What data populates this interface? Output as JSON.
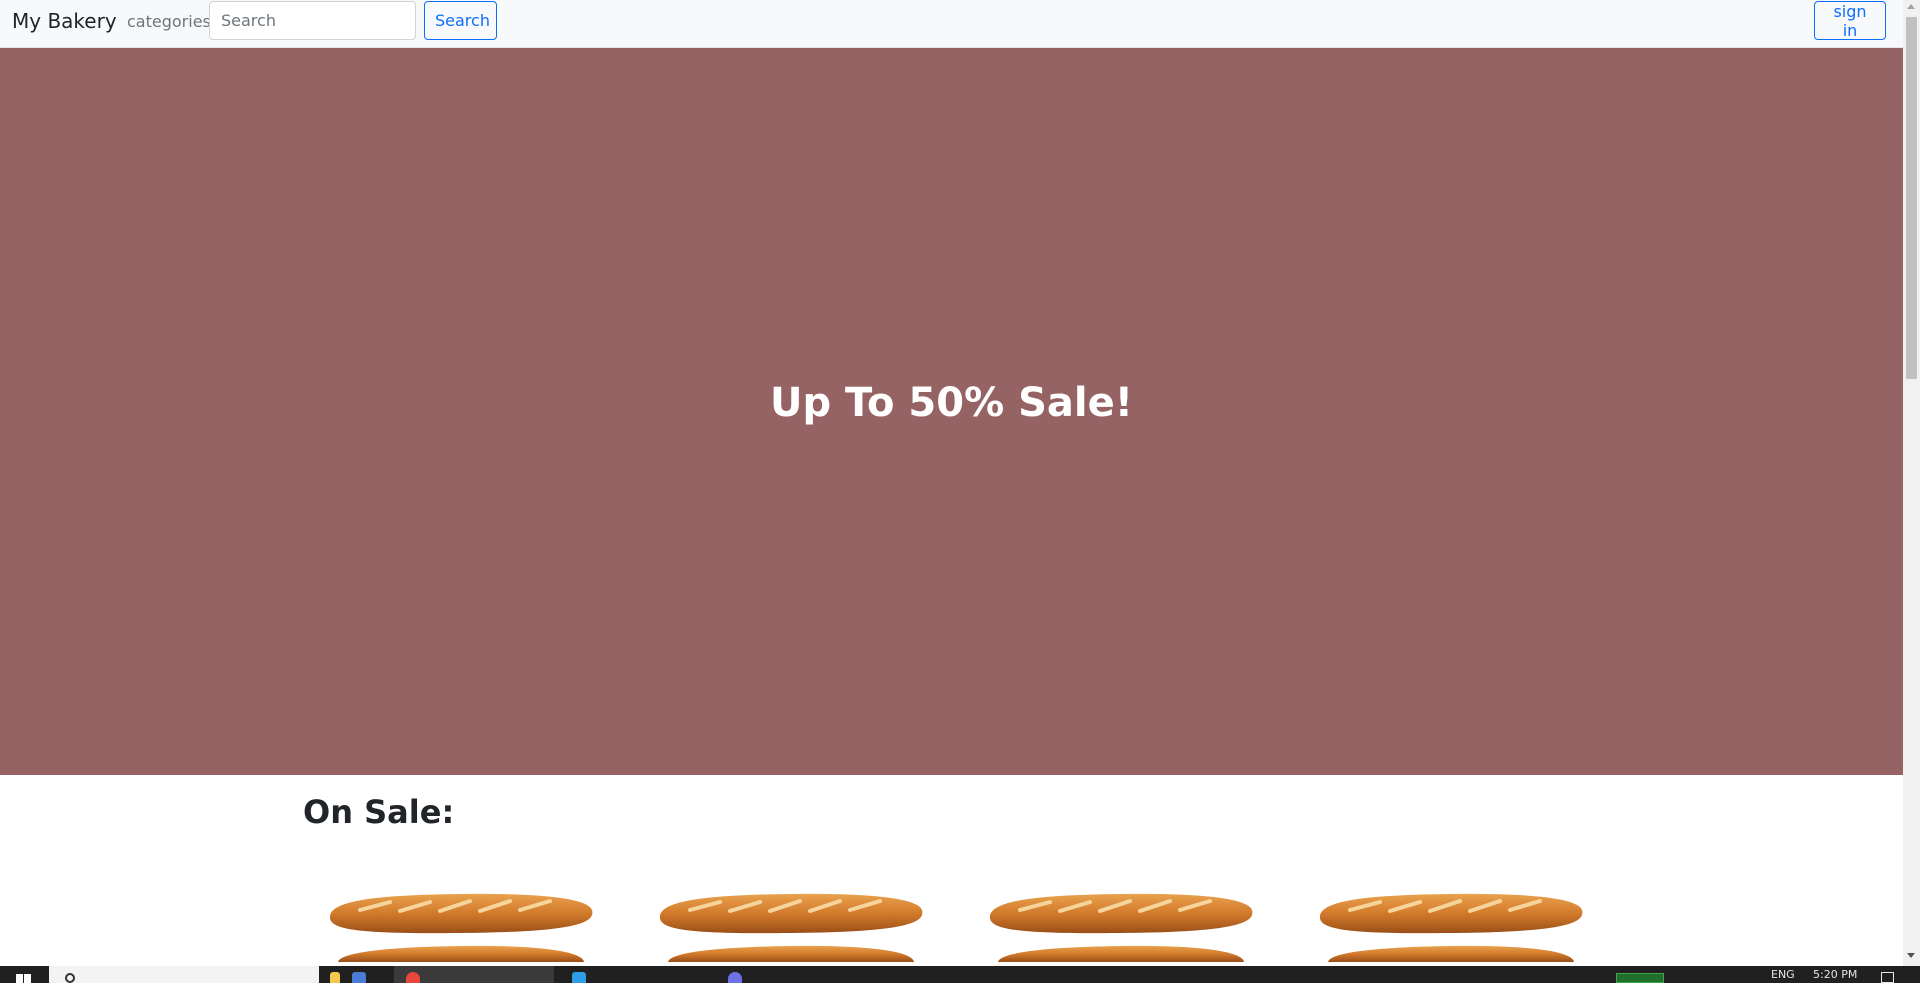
{
  "navbar": {
    "brand": "My Bakery",
    "categories_label": "categories",
    "search_placeholder": "Search",
    "search_value": "",
    "search_button_label": "Search",
    "signin_button_label": "sign in"
  },
  "hero": {
    "title": "Up To 50% Sale!",
    "background_color": "#956363"
  },
  "on_sale": {
    "heading": "On Sale:",
    "products": [
      {
        "image": "baguette"
      },
      {
        "image": "baguette"
      },
      {
        "image": "baguette"
      },
      {
        "image": "baguette"
      }
    ]
  },
  "taskbar": {
    "language": "ENG",
    "clock": "5:20 PM",
    "icons": [
      "windows-start-icon",
      "search-icon",
      "copilot-icon",
      "calendar-app-icon",
      "chrome-icon",
      "vscode-icon",
      "discord-icon",
      "battery-icon",
      "notification-icon"
    ]
  },
  "colors": {
    "accent": "#0d6efd",
    "navbar_bg": "#f8f9fa",
    "hero_bg": "#956363",
    "taskbar_bg": "#202020"
  }
}
